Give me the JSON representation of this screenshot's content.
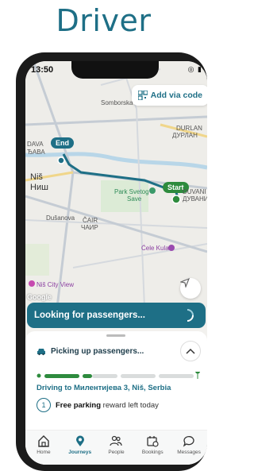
{
  "headline": "Driver",
  "status_bar": {
    "time": "13:50"
  },
  "map": {
    "add_code_label": "Add via code",
    "pins": {
      "end": "End",
      "start": "Start"
    },
    "labels": {
      "somborska": "Somborska",
      "durlan": "DURLAN",
      "durlan_cyr": "ДУРЛАН",
      "dava": "DAVA",
      "dava_cyr": "ЂАВА",
      "nis": "Niš",
      "nis_cyr": "Ниш",
      "park": "Park Svetog",
      "park2": "Save",
      "duvani": "DUVANI",
      "duvani_cyr": "ДУВАНИ",
      "dudanova": "Dušanova",
      "cair": "ČAIR",
      "cair_cyr": "ЧАИР",
      "cele_kula": "Ćele Kula",
      "nis_city_view": "Niš City View",
      "google": "Google"
    }
  },
  "banner": {
    "text": "Looking for passengers..."
  },
  "sheet": {
    "status": "Picking up passengers...",
    "destination": "Driving to Милентијева 3, Niš, Serbia",
    "parking_count": "1",
    "parking_bold": "Free parking",
    "parking_rest": "reward left today",
    "progress": {
      "segments": 4,
      "completed_fraction": 0.33
    }
  },
  "tabs": [
    {
      "label": "Home",
      "icon": "home-icon"
    },
    {
      "label": "Journeys",
      "icon": "location-pin-icon",
      "active": true
    },
    {
      "label": "People",
      "icon": "people-icon"
    },
    {
      "label": "Bookings",
      "icon": "calendar-icon"
    },
    {
      "label": "Messages",
      "icon": "chat-icon"
    }
  ],
  "colors": {
    "brand": "#1e6f86",
    "progress": "#2e8b3e",
    "start_pin": "#2e8b3e"
  }
}
